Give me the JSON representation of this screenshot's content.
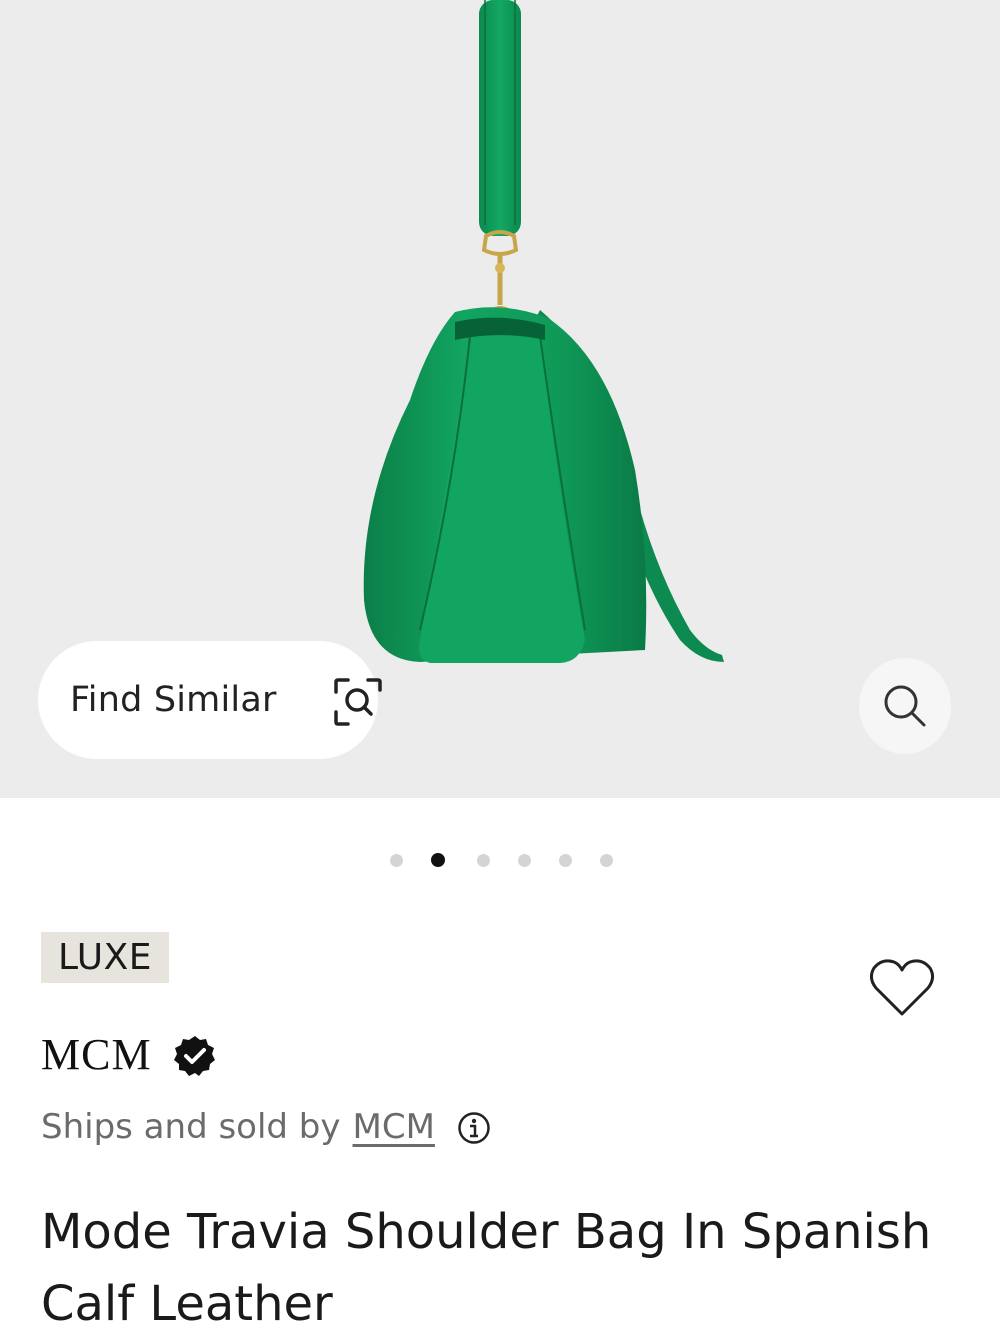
{
  "hero": {
    "find_similar_label": "Find Similar",
    "find_similar_icon": "visual-search-icon",
    "zoom_icon": "search-icon",
    "product_color": "#0f9958",
    "background_color": "#ececec"
  },
  "carousel": {
    "total_images": 6,
    "active_index": 1
  },
  "product": {
    "badge": "LUXE",
    "brand": "MCM",
    "brand_verified_icon": "verified-badge-icon",
    "ships_prefix": "Ships and sold by",
    "seller": "MCM",
    "info_icon": "info-icon",
    "wishlist_icon": "heart-icon",
    "title": "Mode Travia Shoulder Bag In Spanish Calf Leather"
  }
}
